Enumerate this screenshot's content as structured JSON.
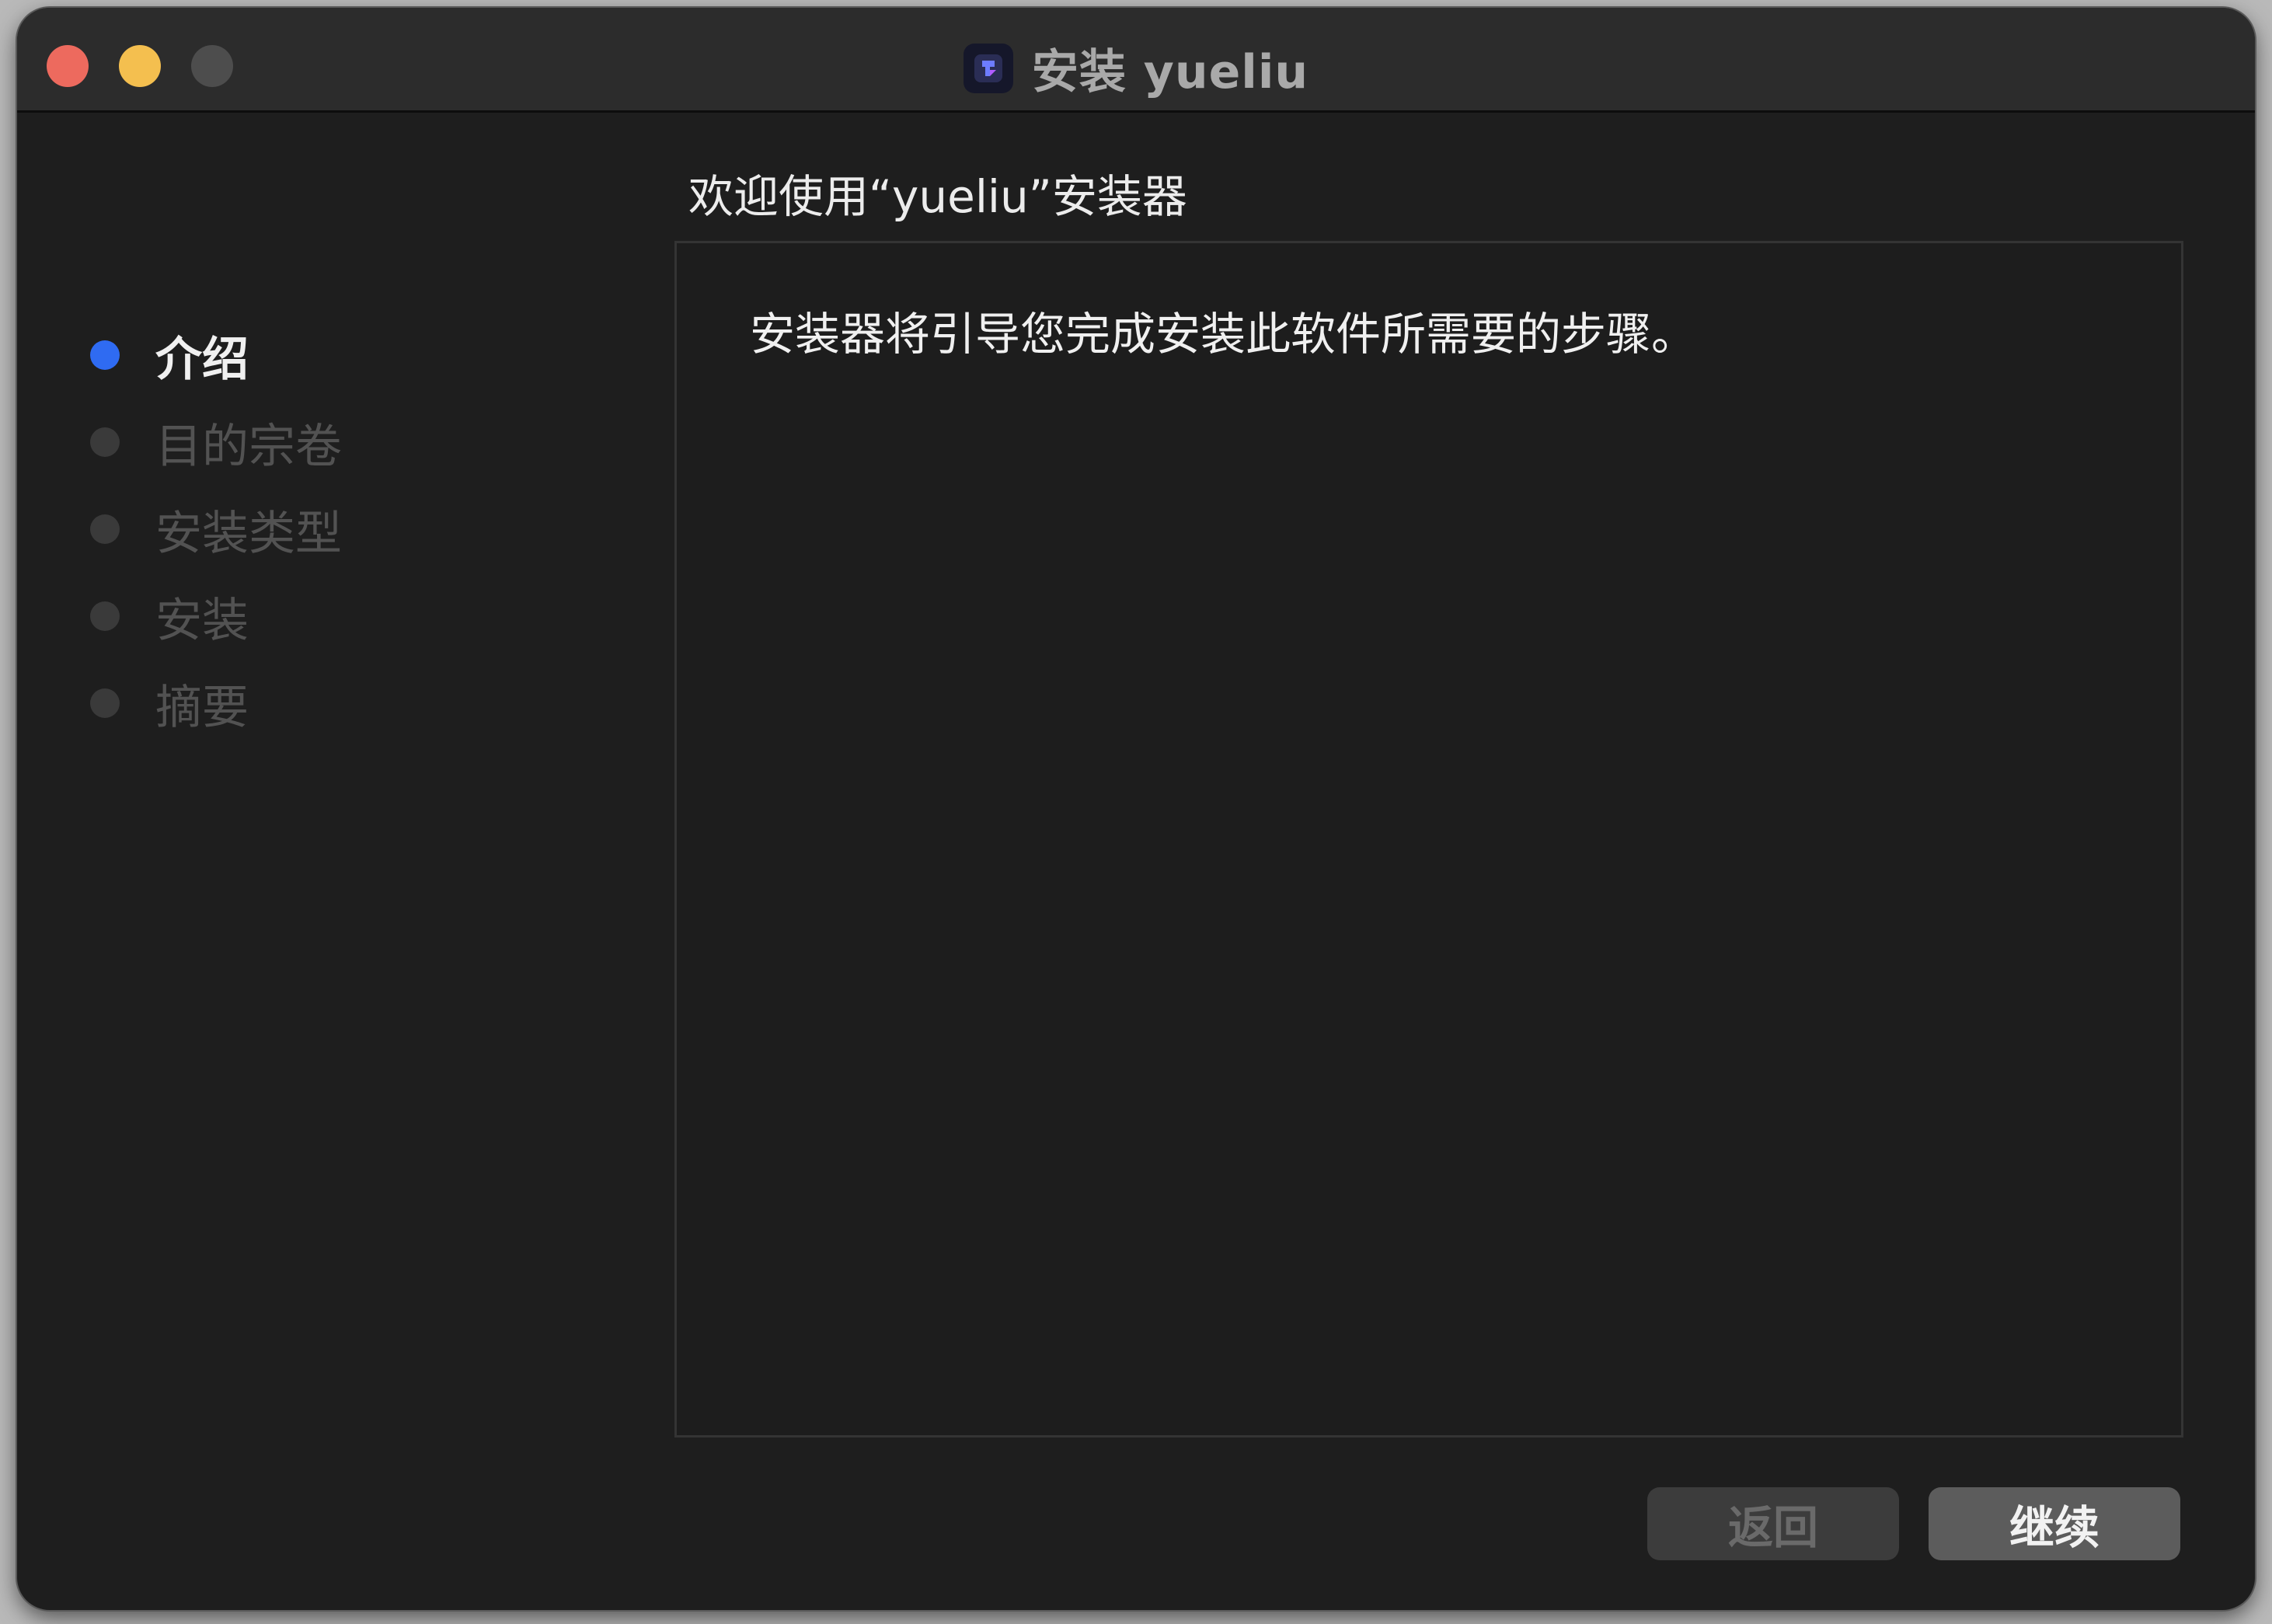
{
  "window": {
    "title": "安装 yueliu",
    "app_icon": "yueliu-app-icon"
  },
  "sidebar": {
    "steps": [
      {
        "label": "介绍",
        "active": true
      },
      {
        "label": "目的宗卷",
        "active": false
      },
      {
        "label": "安装类型",
        "active": false
      },
      {
        "label": "安装",
        "active": false
      },
      {
        "label": "摘要",
        "active": false
      }
    ]
  },
  "main": {
    "heading": "欢迎使用“yueliu”安装器",
    "body_text": "安装器将引导您完成安装此软件所需要的步骤。"
  },
  "buttons": {
    "back_label": "返回",
    "continue_label": "继续",
    "back_enabled": false
  },
  "colors": {
    "active_step": "#2f6bf2",
    "close": "#ed6a5e",
    "minimize": "#f4bf4f"
  }
}
